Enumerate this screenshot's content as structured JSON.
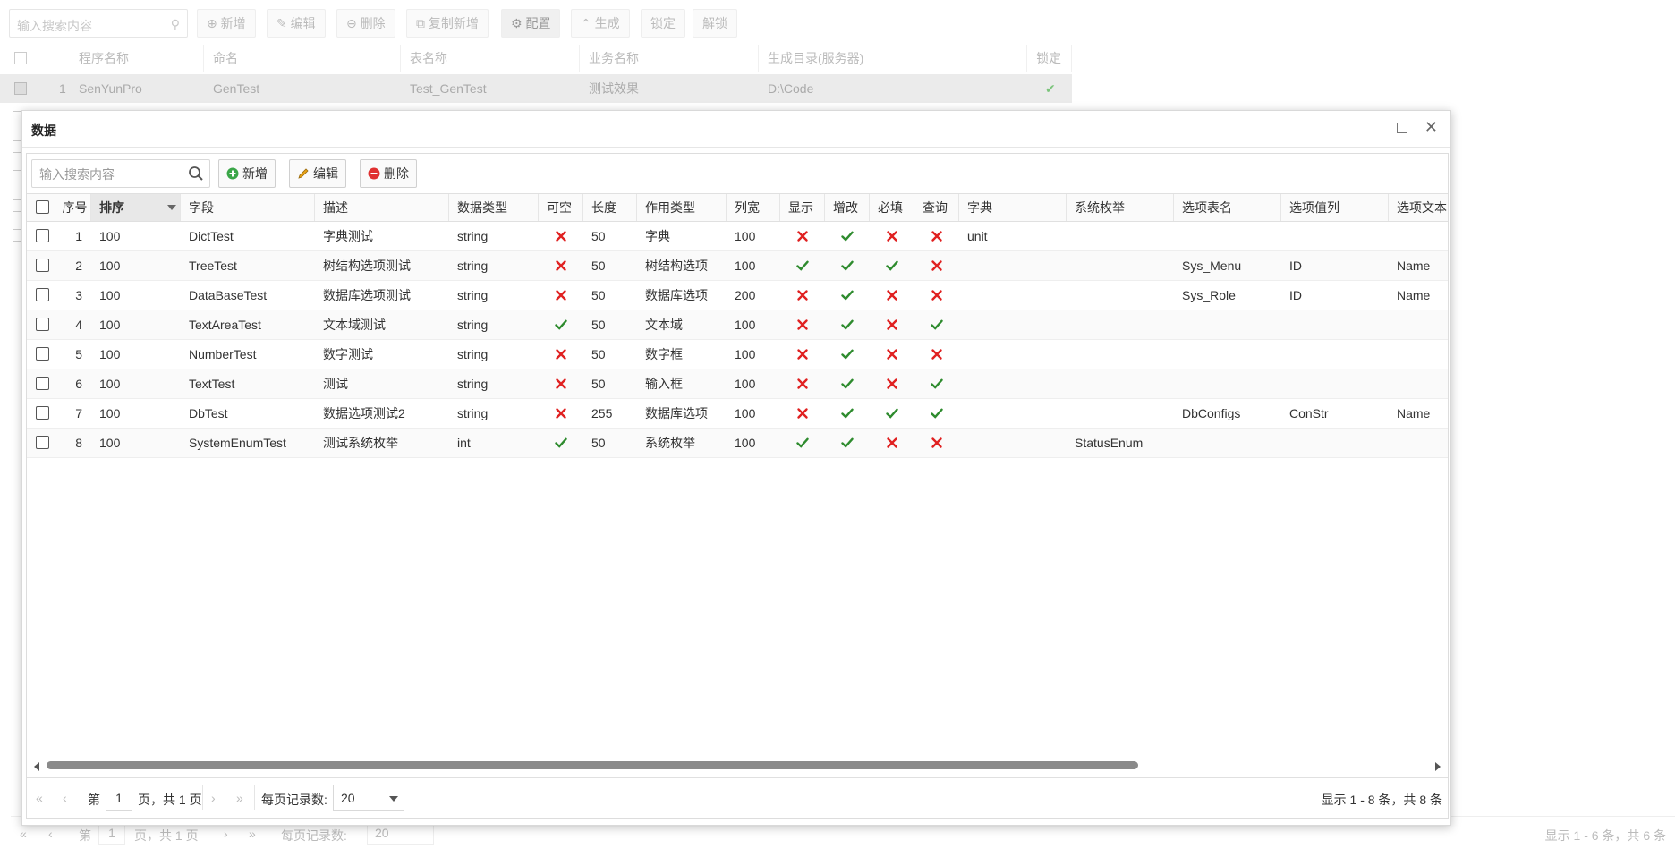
{
  "background": {
    "search_placeholder": "输入搜索内容",
    "toolbar": {
      "add": "新增",
      "edit": "编辑",
      "delete": "删除",
      "copy_add": "复制新增",
      "config": "配置",
      "generate": "生成",
      "lock": "锁定",
      "unlock": "解锁"
    },
    "columns": [
      "程序名称",
      "命名",
      "表名称",
      "业务名称",
      "生成目录(服务器)",
      "锁定"
    ],
    "row": {
      "index": "1",
      "program": "SenYunPro",
      "name": "GenTest",
      "table": "Test_GenTest",
      "business": "测试效果",
      "dir": "D:\\Code",
      "locked": true
    },
    "pager": {
      "page_prefix": "第",
      "page": "1",
      "page_suffix": "页，共 1 页",
      "per_page_label": "每页记录数:",
      "per_page": "20",
      "summary": "显示 1 - 6 条，共 6 条"
    }
  },
  "dialog": {
    "title": "数据",
    "search_placeholder": "输入搜索内容",
    "toolbar": {
      "add": "新增",
      "edit": "编辑",
      "delete": "删除"
    },
    "columns": {
      "index": "序号",
      "sort": "排序",
      "field": "字段",
      "desc": "描述",
      "type": "数据类型",
      "nullable": "可空",
      "length": "长度",
      "role": "作用类型",
      "width": "列宽",
      "show": "显示",
      "editable": "增改",
      "required": "必填",
      "query": "查询",
      "dict": "字典",
      "sys_enum": "系统枚举",
      "opt_table": "选项表名",
      "opt_value": "选项值列",
      "opt_text": "选项文本"
    },
    "rows": [
      {
        "index": "1",
        "sort": "100",
        "field": "DictTest",
        "desc": "字典测试",
        "type": "string",
        "nullable": false,
        "length": "50",
        "role": "字典",
        "width": "100",
        "show": false,
        "editable": true,
        "required": false,
        "query": false,
        "dict": "unit",
        "sys_enum": "",
        "opt_table": "",
        "opt_value": "",
        "opt_text": ""
      },
      {
        "index": "2",
        "sort": "100",
        "field": "TreeTest",
        "desc": "树结构选项测试",
        "type": "string",
        "nullable": false,
        "length": "50",
        "role": "树结构选项",
        "width": "100",
        "show": true,
        "editable": true,
        "required": true,
        "query": false,
        "dict": "",
        "sys_enum": "",
        "opt_table": "Sys_Menu",
        "opt_value": "ID",
        "opt_text": "Name"
      },
      {
        "index": "3",
        "sort": "100",
        "field": "DataBaseTest",
        "desc": "数据库选项测试",
        "type": "string",
        "nullable": false,
        "length": "50",
        "role": "数据库选项",
        "width": "200",
        "show": false,
        "editable": true,
        "required": false,
        "query": false,
        "dict": "",
        "sys_enum": "",
        "opt_table": "Sys_Role",
        "opt_value": "ID",
        "opt_text": "Name"
      },
      {
        "index": "4",
        "sort": "100",
        "field": "TextAreaTest",
        "desc": "文本域测试",
        "type": "string",
        "nullable": true,
        "length": "50",
        "role": "文本域",
        "width": "100",
        "show": false,
        "editable": true,
        "required": false,
        "query": true,
        "dict": "",
        "sys_enum": "",
        "opt_table": "",
        "opt_value": "",
        "opt_text": ""
      },
      {
        "index": "5",
        "sort": "100",
        "field": "NumberTest",
        "desc": "数字测试",
        "type": "string",
        "nullable": false,
        "length": "50",
        "role": "数字框",
        "width": "100",
        "show": false,
        "editable": true,
        "required": false,
        "query": false,
        "dict": "",
        "sys_enum": "",
        "opt_table": "",
        "opt_value": "",
        "opt_text": ""
      },
      {
        "index": "6",
        "sort": "100",
        "field": "TextTest",
        "desc": "测试",
        "type": "string",
        "nullable": false,
        "length": "50",
        "role": "输入框",
        "width": "100",
        "show": false,
        "editable": true,
        "required": false,
        "query": true,
        "dict": "",
        "sys_enum": "",
        "opt_table": "",
        "opt_value": "",
        "opt_text": ""
      },
      {
        "index": "7",
        "sort": "100",
        "field": "DbTest",
        "desc": "数据选项测试2",
        "type": "string",
        "nullable": false,
        "length": "255",
        "role": "数据库选项",
        "width": "100",
        "show": false,
        "editable": true,
        "required": true,
        "query": true,
        "dict": "",
        "sys_enum": "",
        "opt_table": "DbConfigs",
        "opt_value": "ConStr",
        "opt_text": "Name"
      },
      {
        "index": "8",
        "sort": "100",
        "field": "SystemEnumTest",
        "desc": "测试系统枚举",
        "type": "int",
        "nullable": true,
        "length": "50",
        "role": "系统枚举",
        "width": "100",
        "show": true,
        "editable": true,
        "required": false,
        "query": false,
        "dict": "",
        "sys_enum": "StatusEnum",
        "opt_table": "",
        "opt_value": "",
        "opt_text": ""
      }
    ],
    "pager": {
      "page_prefix": "第",
      "page": "1",
      "page_suffix": "页，共 1 页",
      "per_page_label": "每页记录数:",
      "per_page": "20",
      "summary": "显示 1 - 8 条，共 8 条"
    }
  },
  "colors": {
    "check": "#2e8b2e",
    "cross": "#e02020",
    "add_icon": "#3aa648",
    "delete_icon": "#e03030",
    "edit_icon": "#e8a317"
  }
}
